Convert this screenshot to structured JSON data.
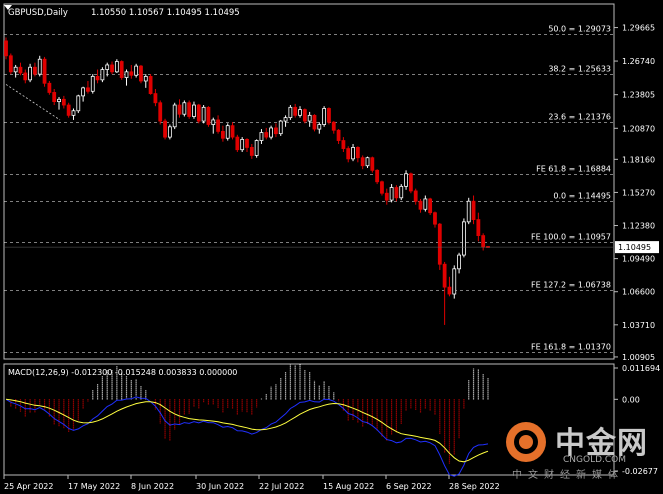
{
  "header": {
    "symbol": "GBPUSD,Daily",
    "ohlc": "1.10550 1.10567 1.10495 1.10495"
  },
  "current_price_label": "1.10495",
  "price_axis": {
    "ticks": [
      "1.29665",
      "1.26740",
      "1.23805",
      "1.20870",
      "1.18160",
      "1.15270",
      "1.12380",
      "1.09490",
      "1.06600",
      "1.03710",
      "1.00905"
    ],
    "values": [
      1.29665,
      1.2674,
      1.23805,
      1.2087,
      1.1816,
      1.1527,
      1.1238,
      1.0949,
      1.066,
      1.0371,
      1.00905
    ]
  },
  "fib_levels": [
    {
      "label": "50.0 = 1.29073",
      "price": 1.29073
    },
    {
      "label": "38.2 = 1.25633",
      "price": 1.25633
    },
    {
      "label": "23.6 = 1.21376",
      "price": 1.21376
    },
    {
      "label": "FE 61.8 = 1.16884",
      "price": 1.16884
    },
    {
      "label": "0.0 = 1.14495",
      "price": 1.14495
    },
    {
      "label": "FE 100.0 = 1.10957",
      "price": 1.10957
    },
    {
      "label": "FE 127.2 = 1.06738",
      "price": 1.06738
    },
    {
      "label": "FE 161.8 = 1.01370",
      "price": 1.0137
    }
  ],
  "macd": {
    "label": "MACD(12,26,9) -0.012300 -0.015248 0.003833 0.000000",
    "ticks": [
      "0.011694",
      "0.00",
      "-0.02677"
    ],
    "tick_values": [
      0.011694,
      0.0,
      -0.02677
    ]
  },
  "date_axis": [
    "25 Apr 2022",
    "17 May 2022",
    "8 Jun 2022",
    "30 Jun 2022",
    "22 Jul 2022",
    "15 Aug 2022",
    "6 Sep 2022",
    "28 Sep 2022"
  ],
  "watermark": {
    "name_cn": "中金网",
    "name_en": "CNGOLD.COM",
    "tagline": "中文财经新媒体"
  },
  "colors": {
    "bull": "#ffffff",
    "bear": "#e00000",
    "macd_main": "#2030ff",
    "macd_signal": "#ffff40",
    "grid": "#ffffff"
  },
  "chart_data": {
    "type": "candlestick",
    "price_range": [
      1.009,
      1.305
    ],
    "candles": [
      [
        1.285,
        1.288,
        1.269,
        1.272
      ],
      [
        1.272,
        1.274,
        1.256,
        1.258
      ],
      [
        1.258,
        1.264,
        1.253,
        1.262
      ],
      [
        1.262,
        1.266,
        1.255,
        1.257
      ],
      [
        1.257,
        1.26,
        1.248,
        1.251
      ],
      [
        1.251,
        1.265,
        1.249,
        1.262
      ],
      [
        1.262,
        1.266,
        1.254,
        1.256
      ],
      [
        1.256,
        1.272,
        1.254,
        1.269
      ],
      [
        1.269,
        1.271,
        1.245,
        1.248
      ],
      [
        1.248,
        1.25,
        1.238,
        1.24
      ],
      [
        1.24,
        1.243,
        1.229,
        1.232
      ],
      [
        1.232,
        1.236,
        1.225,
        1.234
      ],
      [
        1.234,
        1.237,
        1.226,
        1.229
      ],
      [
        1.229,
        1.231,
        1.218,
        1.22
      ],
      [
        1.22,
        1.226,
        1.216,
        1.224
      ],
      [
        1.224,
        1.238,
        1.222,
        1.237
      ],
      [
        1.237,
        1.245,
        1.232,
        1.244
      ],
      [
        1.244,
        1.25,
        1.239,
        1.241
      ],
      [
        1.241,
        1.256,
        1.239,
        1.254
      ],
      [
        1.254,
        1.26,
        1.248,
        1.251
      ],
      [
        1.251,
        1.262,
        1.249,
        1.26
      ],
      [
        1.26,
        1.266,
        1.254,
        1.264
      ],
      [
        1.264,
        1.267,
        1.256,
        1.258
      ],
      [
        1.258,
        1.269,
        1.257,
        1.267
      ],
      [
        1.267,
        1.268,
        1.251,
        1.253
      ],
      [
        1.253,
        1.26,
        1.246,
        1.258
      ],
      [
        1.258,
        1.264,
        1.252,
        1.255
      ],
      [
        1.255,
        1.265,
        1.253,
        1.263
      ],
      [
        1.263,
        1.264,
        1.248,
        1.25
      ],
      [
        1.25,
        1.256,
        1.244,
        1.254
      ],
      [
        1.254,
        1.256,
        1.238,
        1.239
      ],
      [
        1.239,
        1.243,
        1.228,
        1.231
      ],
      [
        1.231,
        1.233,
        1.212,
        1.215
      ],
      [
        1.215,
        1.217,
        1.199,
        1.201
      ],
      [
        1.201,
        1.212,
        1.199,
        1.21
      ],
      [
        1.21,
        1.231,
        1.208,
        1.229
      ],
      [
        1.229,
        1.234,
        1.218,
        1.221
      ],
      [
        1.221,
        1.233,
        1.219,
        1.231
      ],
      [
        1.231,
        1.233,
        1.217,
        1.219
      ],
      [
        1.219,
        1.232,
        1.217,
        1.229
      ],
      [
        1.229,
        1.23,
        1.213,
        1.215
      ],
      [
        1.215,
        1.229,
        1.213,
        1.227
      ],
      [
        1.227,
        1.228,
        1.21,
        1.212
      ],
      [
        1.212,
        1.218,
        1.204,
        1.216
      ],
      [
        1.216,
        1.22,
        1.204,
        1.206
      ],
      [
        1.206,
        1.211,
        1.197,
        1.2
      ],
      [
        1.2,
        1.213,
        1.198,
        1.211
      ],
      [
        1.211,
        1.214,
        1.199,
        1.201
      ],
      [
        1.201,
        1.203,
        1.188,
        1.19
      ],
      [
        1.19,
        1.201,
        1.188,
        1.199
      ],
      [
        1.199,
        1.2,
        1.188,
        1.192
      ],
      [
        1.192,
        1.195,
        1.182,
        1.185
      ],
      [
        1.185,
        1.199,
        1.183,
        1.198
      ],
      [
        1.198,
        1.208,
        1.195,
        1.205
      ],
      [
        1.205,
        1.209,
        1.199,
        1.201
      ],
      [
        1.201,
        1.211,
        1.199,
        1.209
      ],
      [
        1.209,
        1.213,
        1.201,
        1.204
      ],
      [
        1.204,
        1.216,
        1.202,
        1.215
      ],
      [
        1.215,
        1.22,
        1.21,
        1.218
      ],
      [
        1.218,
        1.229,
        1.216,
        1.227
      ],
      [
        1.227,
        1.23,
        1.218,
        1.22
      ],
      [
        1.22,
        1.228,
        1.218,
        1.225
      ],
      [
        1.225,
        1.226,
        1.213,
        1.215
      ],
      [
        1.215,
        1.223,
        1.21,
        1.22
      ],
      [
        1.22,
        1.221,
        1.206,
        1.208
      ],
      [
        1.208,
        1.214,
        1.204,
        1.212
      ],
      [
        1.212,
        1.228,
        1.21,
        1.226
      ],
      [
        1.226,
        1.227,
        1.212,
        1.214
      ],
      [
        1.214,
        1.215,
        1.204,
        1.207
      ],
      [
        1.207,
        1.208,
        1.195,
        1.198
      ],
      [
        1.198,
        1.201,
        1.188,
        1.191
      ],
      [
        1.191,
        1.193,
        1.179,
        1.182
      ],
      [
        1.182,
        1.195,
        1.18,
        1.192
      ],
      [
        1.192,
        1.193,
        1.179,
        1.183
      ],
      [
        1.183,
        1.185,
        1.173,
        1.176
      ],
      [
        1.176,
        1.184,
        1.174,
        1.183
      ],
      [
        1.183,
        1.184,
        1.17,
        1.172
      ],
      [
        1.172,
        1.173,
        1.16,
        1.162
      ],
      [
        1.162,
        1.163,
        1.15,
        1.152
      ],
      [
        1.152,
        1.156,
        1.142,
        1.146
      ],
      [
        1.146,
        1.16,
        1.144,
        1.157
      ],
      [
        1.157,
        1.159,
        1.145,
        1.148
      ],
      [
        1.148,
        1.16,
        1.146,
        1.158
      ],
      [
        1.158,
        1.172,
        1.155,
        1.169
      ],
      [
        1.169,
        1.17,
        1.152,
        1.154
      ],
      [
        1.154,
        1.156,
        1.142,
        1.145
      ],
      [
        1.145,
        1.147,
        1.135,
        1.138
      ],
      [
        1.138,
        1.15,
        1.136,
        1.147
      ],
      [
        1.147,
        1.148,
        1.133,
        1.135
      ],
      [
        1.135,
        1.136,
        1.122,
        1.125
      ],
      [
        1.125,
        1.126,
        1.085,
        1.09
      ],
      [
        1.09,
        1.092,
        1.037,
        1.07
      ],
      [
        1.07,
        1.079,
        1.062,
        1.064
      ],
      [
        1.064,
        1.089,
        1.06,
        1.086
      ],
      [
        1.086,
        1.1,
        1.082,
        1.098
      ],
      [
        1.098,
        1.13,
        1.096,
        1.127
      ],
      [
        1.127,
        1.148,
        1.125,
        1.145
      ],
      [
        1.145,
        1.15,
        1.125,
        1.129
      ],
      [
        1.129,
        1.135,
        1.11,
        1.115
      ],
      [
        1.115,
        1.117,
        1.102,
        1.105
      ],
      [
        1.1055,
        1.10567,
        1.10495,
        1.10495
      ]
    ]
  }
}
